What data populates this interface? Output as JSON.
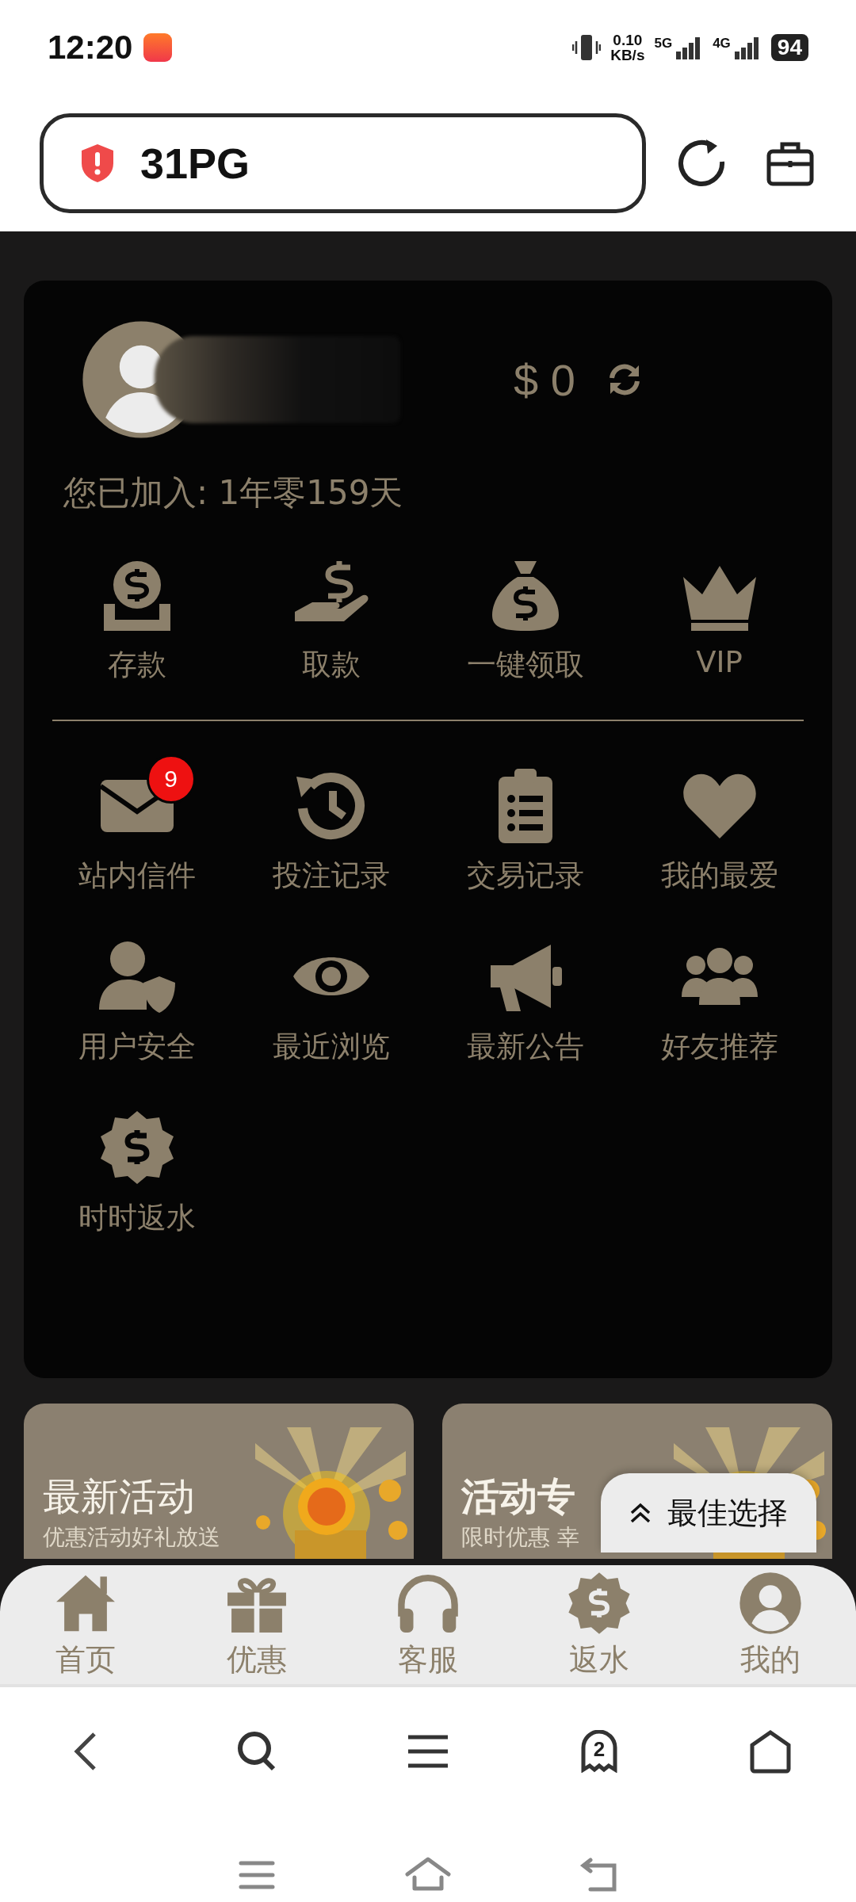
{
  "status_bar": {
    "time": "12:20",
    "net_speed": "0.10",
    "net_unit": "KB/s",
    "sim_1": "5G",
    "sim_2": "4G",
    "battery": "94"
  },
  "address_bar": {
    "text": "31PG"
  },
  "account": {
    "balance": "$ 0",
    "joined": "您已加入: 1年零159天"
  },
  "quick_actions": [
    {
      "label": "存款"
    },
    {
      "label": "取款"
    },
    {
      "label": "一键领取"
    },
    {
      "label": "VIP"
    }
  ],
  "menu": [
    {
      "label": "站内信件",
      "badge": "9"
    },
    {
      "label": "投注记录"
    },
    {
      "label": "交易记录"
    },
    {
      "label": "我的最爱"
    },
    {
      "label": "用户安全"
    },
    {
      "label": "最近浏览"
    },
    {
      "label": "最新公告"
    },
    {
      "label": "好友推荐"
    },
    {
      "label": "时时返水"
    }
  ],
  "promos": [
    {
      "title": "最新活动",
      "subtitle": "优惠活动好礼放送"
    },
    {
      "title": "活动专",
      "subtitle": "限时优惠 幸"
    }
  ],
  "float_button": {
    "label": "最佳选择"
  },
  "tab_bar": [
    {
      "label": "首页"
    },
    {
      "label": "优惠"
    },
    {
      "label": "客服"
    },
    {
      "label": "返水"
    },
    {
      "label": "我的"
    }
  ],
  "browser_toolbar": {
    "tab_count": "2"
  }
}
